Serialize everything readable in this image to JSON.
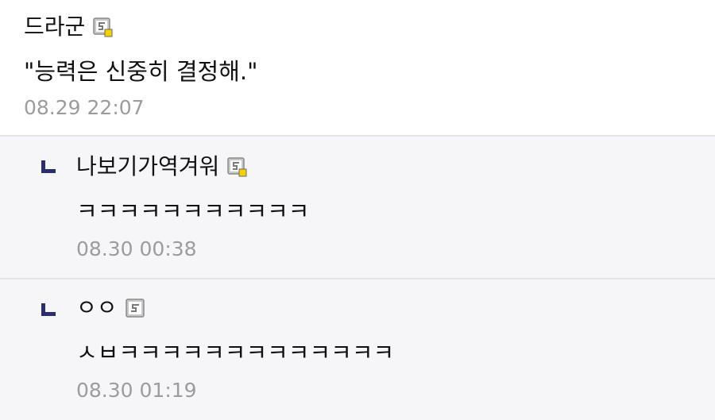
{
  "comments": [
    {
      "author": "드라군",
      "icon": "user-icon-fixed-member",
      "text": "\"능력은 신중히 결정해.\"",
      "timestamp": "08.29 22:07"
    }
  ],
  "replies": [
    {
      "author": "나보기가역겨워",
      "icon": "user-icon-fixed-member",
      "text": "ㅋㅋㅋㅋㅋㅋㅋㅋㅋㅋㅋ",
      "timestamp": "08.30 00:38"
    },
    {
      "author": "ㅇㅇ",
      "icon": "user-icon-guest",
      "text": "ㅅㅂㅋㅋㅋㅋㅋㅋㅋㅋㅋㅋㅋㅋㅋ",
      "timestamp": "08.30 01:19"
    }
  ],
  "colors": {
    "reply_background": "#f6f6f9",
    "reply_arrow": "#2b2d6e",
    "timestamp": "#9c9c9c",
    "divider": "#e2e2e8",
    "icon_badge": "#f5d100"
  }
}
